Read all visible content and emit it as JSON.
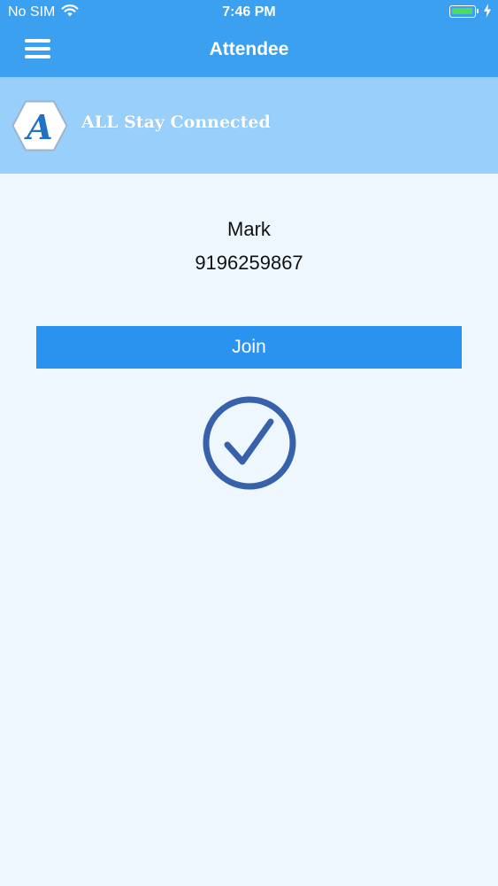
{
  "status_bar": {
    "carrier": "No SIM",
    "time": "7:46 PM",
    "battery_level": 0.9,
    "charging": true
  },
  "nav": {
    "title": "Attendee",
    "menu_icon": "hamburger-menu-icon"
  },
  "banner": {
    "logo_letter": "A",
    "brand_name": "ALL Stay Connected"
  },
  "attendee": {
    "name": "Mark",
    "phone": "9196259867"
  },
  "actions": {
    "join_label": "Join",
    "status_icon": "checkmark-circle-icon"
  },
  "colors": {
    "top_bar": "#3aa0ef",
    "banner": "#99cffb",
    "background": "#eff7fe",
    "button": "#2a93ef",
    "check": "#3762ab",
    "battery": "#4cd964"
  }
}
